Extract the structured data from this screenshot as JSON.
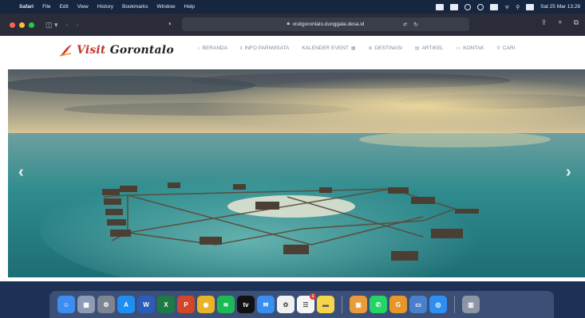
{
  "menubar": {
    "app_name": "Safari",
    "items": [
      "File",
      "Edit",
      "View",
      "History",
      "Bookmarks",
      "Window",
      "Help"
    ],
    "datetime": "Sat 25 Mar 13.28"
  },
  "browser": {
    "url": "visitgorontalo.dunggala.desa.id"
  },
  "site": {
    "logo_main": "Visit",
    "logo_sub": "Gorontalo",
    "nav": [
      {
        "label": "BERANDA",
        "icon": "home-icon",
        "glyph": "⌂"
      },
      {
        "label": "INFO PARIWISATA",
        "icon": "info-icon",
        "glyph": "ℹ"
      },
      {
        "label": "KALENDER EVENT",
        "icon": "calendar-icon",
        "glyph": "▦"
      },
      {
        "label": "DESTINASI",
        "icon": "globe-icon",
        "glyph": "⊕"
      },
      {
        "label": "ARTIKEL",
        "icon": "article-icon",
        "glyph": "▤"
      },
      {
        "label": "KONTAK",
        "icon": "contact-icon",
        "glyph": "▭"
      },
      {
        "label": "CARI",
        "icon": "search-icon",
        "glyph": "⚲"
      }
    ],
    "slider": {
      "prev": "‹",
      "next": "›",
      "slides": 3,
      "active": 0
    }
  },
  "dock": {
    "apps": [
      {
        "name": "finder",
        "color": "#3d8cf0",
        "glyph": "☺"
      },
      {
        "name": "launchpad",
        "color": "#8e9bb5",
        "glyph": "▦"
      },
      {
        "name": "system-settings",
        "color": "#7d8593",
        "glyph": "⚙"
      },
      {
        "name": "app-store",
        "color": "#1f8ef1",
        "glyph": "A"
      },
      {
        "name": "word",
        "color": "#2b5cb8",
        "glyph": "W"
      },
      {
        "name": "excel",
        "color": "#1e7b45",
        "glyph": "X"
      },
      {
        "name": "powerpoint",
        "color": "#d2462b",
        "glyph": "P"
      },
      {
        "name": "chrome",
        "color": "#e8b32a",
        "glyph": "◉"
      },
      {
        "name": "spotify",
        "color": "#1db954",
        "glyph": "≋"
      },
      {
        "name": "apple-tv",
        "color": "#111111",
        "glyph": "tv"
      },
      {
        "name": "mail",
        "color": "#3a8ef0",
        "glyph": "✉"
      },
      {
        "name": "photos",
        "color": "#f0f0f0",
        "glyph": "✿"
      },
      {
        "name": "reminders",
        "color": "#f5f5f5",
        "glyph": "☰",
        "badge": "1"
      },
      {
        "name": "notes",
        "color": "#f7d54a",
        "glyph": "▬"
      },
      {
        "name": "preview",
        "color": "#e89a3c",
        "glyph": "▣"
      },
      {
        "name": "whatsapp",
        "color": "#25d366",
        "glyph": "✆"
      },
      {
        "name": "gorontalo-app",
        "color": "#e8962a",
        "glyph": "G"
      },
      {
        "name": "folder",
        "color": "#4a7fc9",
        "glyph": "▭"
      },
      {
        "name": "safari",
        "color": "#2f8ff0",
        "glyph": "◎"
      }
    ],
    "trash": {
      "name": "trash",
      "color": "#8e96a6",
      "glyph": "▥"
    }
  }
}
